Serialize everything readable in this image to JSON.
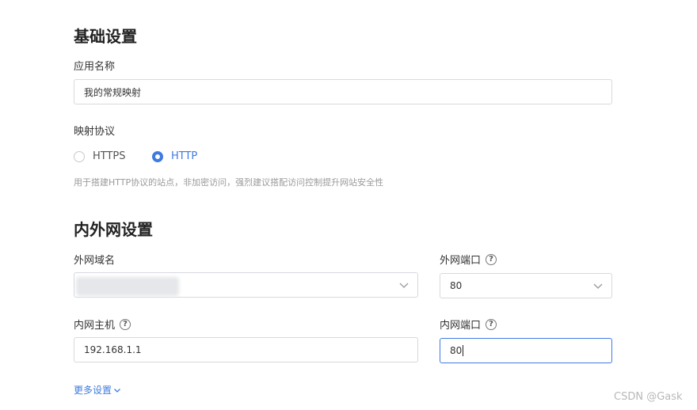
{
  "basic": {
    "title": "基础设置",
    "app_name_label": "应用名称",
    "app_name_value": "我的常规映射",
    "protocol_label": "映射协议",
    "protocols": [
      {
        "label": "HTTPS",
        "checked": false
      },
      {
        "label": "HTTP",
        "checked": true
      }
    ],
    "protocol_hint": "用于搭建HTTP协议的站点，非加密访问，强烈建议搭配访问控制提升网站安全性"
  },
  "network": {
    "title": "内外网设置",
    "domain_label": "外网域名",
    "domain_value": "",
    "external_port_label": "外网端口",
    "external_port_value": "80",
    "internal_host_label": "内网主机",
    "internal_host_value": "192.168.1.1",
    "internal_port_label": "内网端口",
    "internal_port_value": "80"
  },
  "more_settings": "更多设置",
  "watermark": "CSDN @Gask",
  "colors": {
    "accent": "#3e7be0",
    "border": "#d7d9de"
  },
  "icons": [
    "help-circle-icon",
    "chevron-down-icon",
    "radio-icon"
  ]
}
